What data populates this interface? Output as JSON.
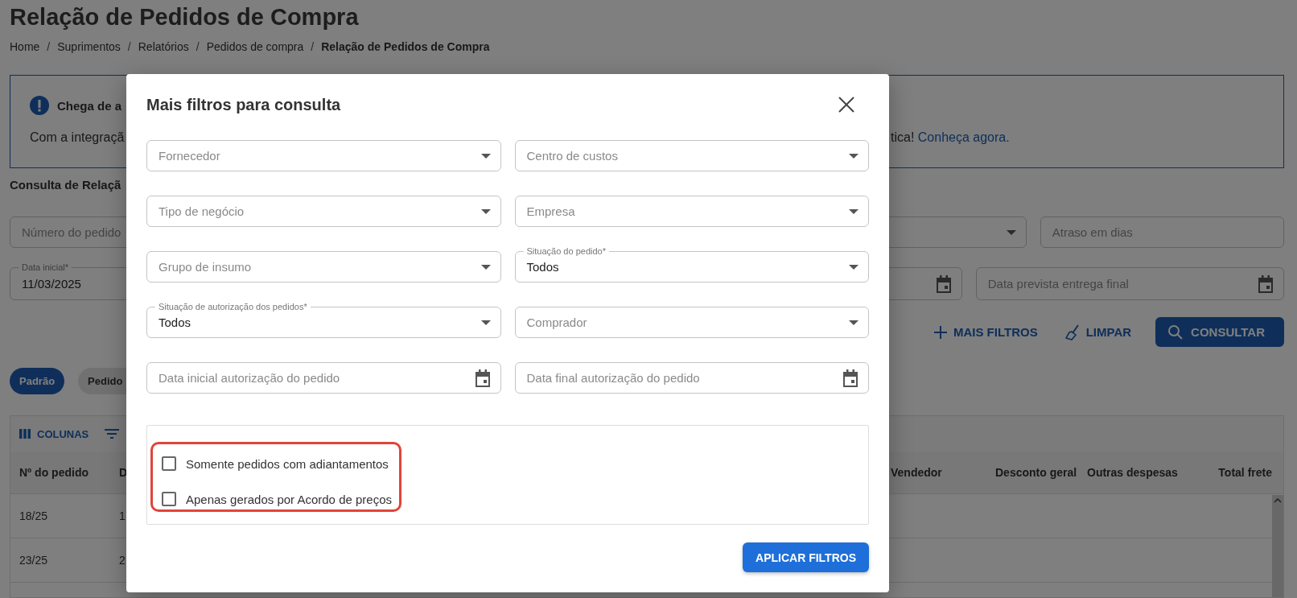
{
  "page": {
    "title": "Relação de Pedidos de Compra",
    "breadcrumb": [
      {
        "label": "Home",
        "current": false
      },
      {
        "label": "Suprimentos",
        "current": false
      },
      {
        "label": "Relatórios",
        "current": false
      },
      {
        "label": "Pedidos de compra",
        "current": false
      },
      {
        "label": "Relação de Pedidos de Compra",
        "current": true
      }
    ],
    "separator": "/",
    "banner": {
      "title": "Chega de a",
      "text_start": "Com a integraçã",
      "text_end": "tica!",
      "link": "Conheça agora."
    },
    "section_title": "Consulta de Relaçã",
    "filters_row1": [
      {
        "kind": "text",
        "placeholder": "Número do pedido"
      },
      {
        "kind": "select"
      },
      {
        "kind": "text",
        "placeholder": "Atraso em dias"
      }
    ],
    "filters_row2": [
      {
        "kind": "text",
        "label": "Data inicial*",
        "value": "11/03/2025"
      },
      {
        "kind": "date"
      },
      {
        "kind": "date",
        "placeholder": "Data prevista entrega final"
      }
    ],
    "actions": [
      {
        "kind": "add",
        "label": "MAIS FILTROS"
      },
      {
        "kind": "clear",
        "label": "LIMPAR"
      },
      {
        "kind": "search",
        "label": "CONSULTAR"
      }
    ],
    "chips": [
      {
        "label": "Padrão",
        "selected": true
      },
      {
        "label": "Pedido",
        "selected": false
      }
    ],
    "table": {
      "toolbar": [
        {
          "kind": "columns",
          "label": "COLUNAS"
        },
        {
          "kind": "filter"
        }
      ],
      "columns_left": [
        "Nº do pedido",
        "D"
      ],
      "columns_right": [
        "Vendedor",
        "Desconto geral",
        "Outras despesas",
        "Total frete"
      ],
      "rows": [
        [
          "18/25",
          "1"
        ],
        [
          "23/25",
          "2"
        ]
      ]
    }
  },
  "modal": {
    "title": "Mais filtros para consulta",
    "field_rows": [
      [
        {
          "kind": "select",
          "placeholder": "Fornecedor"
        },
        {
          "kind": "select",
          "placeholder": "Centro de custos"
        }
      ],
      [
        {
          "kind": "select",
          "placeholder": "Tipo de negócio"
        },
        {
          "kind": "select",
          "placeholder": "Empresa"
        }
      ],
      [
        {
          "kind": "select",
          "placeholder": "Grupo de insumo"
        },
        {
          "kind": "select",
          "label": "Situação do pedido*",
          "value": "Todos"
        }
      ],
      [
        {
          "kind": "select",
          "label": "Situação de autorização dos pedidos*",
          "value": "Todos"
        },
        {
          "kind": "select",
          "placeholder": "Comprador"
        }
      ],
      [
        {
          "kind": "date",
          "placeholder": "Data inicial autorização do pedido"
        },
        {
          "kind": "date",
          "placeholder": "Data final autorização do pedido"
        }
      ]
    ],
    "checkboxes": [
      {
        "label": "Somente pedidos com adiantamentos",
        "checked": false
      },
      {
        "label": "Apenas gerados por Acordo de preços",
        "checked": false
      }
    ],
    "apply_button": "APLICAR FILTROS"
  }
}
